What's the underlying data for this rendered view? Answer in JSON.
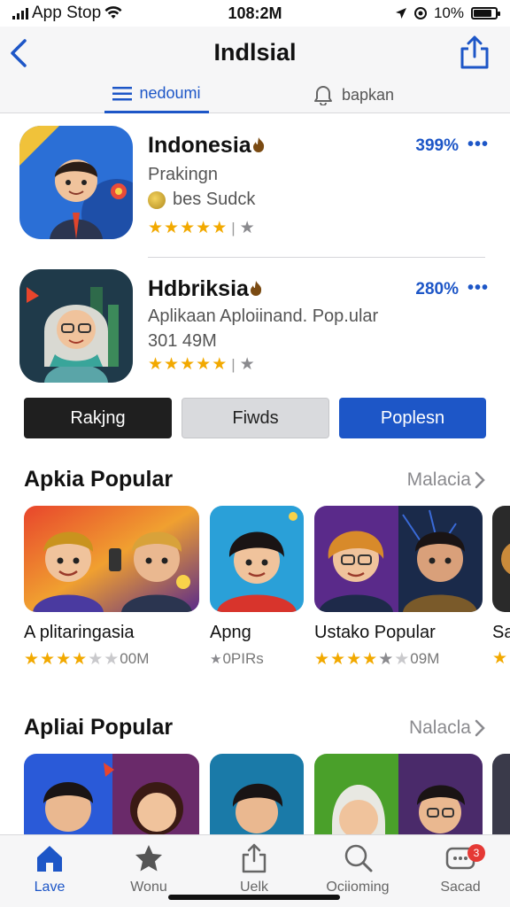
{
  "status_bar": {
    "carrier": "App Stop",
    "time": "108:2M",
    "battery": "10%"
  },
  "header": {
    "title": "Indlsial"
  },
  "tabs": [
    {
      "label": "nedoumi",
      "active": true
    },
    {
      "label": "bapkan",
      "active": false
    }
  ],
  "featured": [
    {
      "name": "Indonesia",
      "subtitle": "Prakingn",
      "detail": "bes Sudck",
      "percent": "399%",
      "rating": 5
    },
    {
      "name": "Hdbriksia",
      "subtitle": "Aplikaan Aploiinand. Pop.ular",
      "detail": "301 49M",
      "percent": "280%",
      "rating": 5
    }
  ],
  "buttons": {
    "ranking": "Rakjng",
    "friends": "Fiwds",
    "popular": "Poplesn"
  },
  "section1": {
    "title": "Apkia Popular",
    "link": "Malacia",
    "cards": [
      {
        "title": "A plitaringasia",
        "rating": 4,
        "meta": "00M"
      },
      {
        "title": "Apng",
        "rating": 0,
        "meta": "0PIRs"
      },
      {
        "title": "Ustako Popular",
        "rating": 4,
        "meta": "09M"
      },
      {
        "title": "Sa",
        "rating": 1,
        "meta": ""
      }
    ]
  },
  "section2": {
    "title": "Apliai Popular",
    "link": "Nalacla"
  },
  "tabbar": [
    {
      "label": "Lave",
      "icon": "home-icon",
      "active": true
    },
    {
      "label": "Wonu",
      "icon": "star-icon",
      "active": false
    },
    {
      "label": "Uelk",
      "icon": "share-icon",
      "active": false
    },
    {
      "label": "Ociioming",
      "icon": "search-icon",
      "active": false
    },
    {
      "label": "Sacad",
      "icon": "chat-icon",
      "active": false,
      "badge": "3"
    }
  ],
  "colors": {
    "accent": "#1d56c7",
    "star": "#f2a900"
  }
}
